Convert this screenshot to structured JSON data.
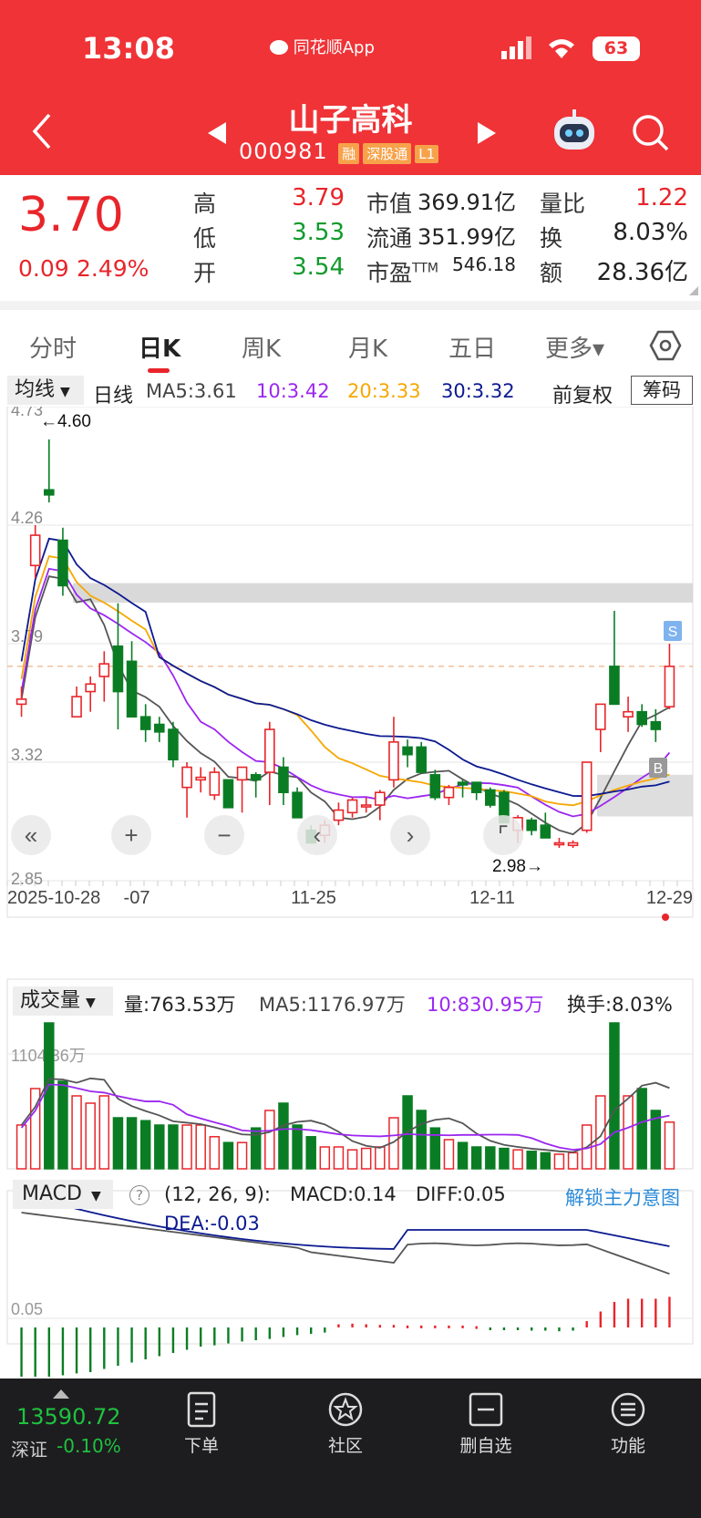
{
  "status": {
    "time": "13:08",
    "app": "同花顺App",
    "battery": "63"
  },
  "header": {
    "name": "山子高科",
    "code": "000981",
    "badges": [
      "融",
      "深股通",
      "L1"
    ]
  },
  "quote": {
    "price": "3.70",
    "change": "0.09",
    "pct": "2.49%",
    "rows": [
      [
        {
          "l": "高",
          "v": "3.79",
          "c": "red"
        },
        {
          "l": "市值",
          "v": "369.91亿",
          "c": "dark"
        },
        {
          "l": "量比",
          "v": "1.22",
          "c": "red"
        }
      ],
      [
        {
          "l": "低",
          "v": "3.53",
          "c": "green"
        },
        {
          "l": "流通",
          "v": "351.99亿",
          "c": "dark"
        },
        {
          "l": "换",
          "v": "8.03%",
          "c": "dark"
        }
      ],
      [
        {
          "l": "开",
          "v": "3.54",
          "c": "green"
        },
        {
          "l": "市盈",
          "v": "546.18",
          "c": "dark",
          "sup": "TTM"
        },
        {
          "l": "额",
          "v": "28.36亿",
          "c": "dark"
        }
      ]
    ]
  },
  "tabs": [
    "分时",
    "日K",
    "周K",
    "月K",
    "五日",
    "更多▾"
  ],
  "active_tab": "日K",
  "kline": {
    "ma_select": "均线",
    "period": "日线",
    "ma5": "MA5:3.61",
    "ma10": "10:3.42",
    "ma20": "20:3.33",
    "ma30": "30:3.32",
    "adjust": "前复权",
    "chip": "筹码",
    "y_labels": [
      "4.73",
      "4.26",
      "3.79",
      "3.32",
      "2.85"
    ],
    "max_label": "←4.60",
    "min_label": "2.98→",
    "x_labels": [
      "2025-10-28",
      "-07",
      "11-25",
      "12-11",
      "12-29"
    ],
    "colors": {
      "up": "#e8252a",
      "down": "#0a7d24",
      "ma5": "#555555",
      "ma10": "#9b27f0",
      "ma20": "#f6a700",
      "ma30": "#0c1a90"
    }
  },
  "volume": {
    "select": "成交量",
    "vol": "量:763.53万",
    "ma5": "MA5:1176.97万",
    "ma10": "10:830.95万",
    "turnover": "换手:8.03%",
    "y_label": "1104.36万"
  },
  "macd": {
    "select": "MACD",
    "params": "(12, 26, 9):",
    "macd": "MACD:0.14",
    "diff": "DIFF:0.05",
    "dea": "DEA:-0.03",
    "unlock": "解锁主力意图",
    "y_label": "0.05"
  },
  "chart_data": [
    {
      "type": "candlestick",
      "title": "山子高科 日K",
      "x": [
        "2025-10-28",
        "11-07",
        "11-25",
        "12-11",
        "12-29"
      ],
      "ylim": [
        2.85,
        4.73
      ],
      "ohlc_approx": [
        [
          3.55,
          3.62,
          3.5,
          3.57
        ],
        [
          4.1,
          4.26,
          4.05,
          4.22
        ],
        [
          4.4,
          4.6,
          4.35,
          4.38
        ],
        [
          4.2,
          4.25,
          3.98,
          4.02
        ],
        [
          3.5,
          3.62,
          3.5,
          3.58
        ],
        [
          3.6,
          3.66,
          3.52,
          3.63
        ],
        [
          3.66,
          3.76,
          3.56,
          3.71
        ],
        [
          3.78,
          3.95,
          3.45,
          3.6
        ],
        [
          3.72,
          3.8,
          3.5,
          3.5
        ],
        [
          3.5,
          3.55,
          3.4,
          3.45
        ],
        [
          3.47,
          3.5,
          3.4,
          3.44
        ],
        [
          3.45,
          3.48,
          3.3,
          3.33
        ],
        [
          3.22,
          3.32,
          3.1,
          3.3
        ],
        [
          3.25,
          3.3,
          3.2,
          3.26
        ],
        [
          3.19,
          3.3,
          3.17,
          3.28
        ],
        [
          3.25,
          3.25,
          3.14,
          3.14
        ],
        [
          3.25,
          3.3,
          3.12,
          3.3
        ],
        [
          3.27,
          3.28,
          3.18,
          3.25
        ],
        [
          3.28,
          3.48,
          3.15,
          3.45
        ],
        [
          3.3,
          3.34,
          3.15,
          3.2
        ],
        [
          3.2,
          3.22,
          3.1,
          3.1
        ],
        [
          3.05,
          3.07,
          3.0,
          3.0
        ],
        [
          3.03,
          3.09,
          3.0,
          3.07
        ],
        [
          3.09,
          3.16,
          3.07,
          3.13
        ],
        [
          3.12,
          3.18,
          3.1,
          3.17
        ],
        [
          3.15,
          3.18,
          3.12,
          3.15
        ],
        [
          3.15,
          3.21,
          3.09,
          3.2
        ],
        [
          3.25,
          3.5,
          3.22,
          3.4
        ],
        [
          3.38,
          3.41,
          3.3,
          3.35
        ],
        [
          3.38,
          3.4,
          3.28,
          3.28
        ],
        [
          3.27,
          3.29,
          3.17,
          3.18
        ],
        [
          3.18,
          3.23,
          3.15,
          3.22
        ],
        [
          3.24,
          3.25,
          3.18,
          3.23
        ],
        [
          3.24,
          3.24,
          3.17,
          3.2
        ],
        [
          3.21,
          3.22,
          3.14,
          3.15
        ],
        [
          3.2,
          3.21,
          3.08,
          3.08
        ],
        [
          3.05,
          3.11,
          3.0,
          3.1
        ],
        [
          3.09,
          3.1,
          3.03,
          3.05
        ],
        [
          3.07,
          3.12,
          3.02,
          3.02
        ],
        [
          3.0,
          3.02,
          2.98,
          3.0
        ],
        [
          2.99,
          3.01,
          2.98,
          3.0
        ],
        [
          3.05,
          3.32,
          3.04,
          3.32
        ],
        [
          3.45,
          3.5,
          3.36,
          3.55
        ],
        [
          3.7,
          3.92,
          3.6,
          3.55
        ],
        [
          3.5,
          3.58,
          3.44,
          3.52
        ],
        [
          3.52,
          3.55,
          3.46,
          3.47
        ],
        [
          3.48,
          3.53,
          3.4,
          3.45
        ],
        [
          3.54,
          3.79,
          3.53,
          3.7
        ]
      ],
      "ma_latest": {
        "MA5": 3.61,
        "MA10": 3.42,
        "MA20": 3.33,
        "MA30": 3.32
      }
    },
    {
      "type": "bar",
      "title": "成交量",
      "ylabel": "万",
      "series": [
        {
          "name": "量",
          "latest": 763.53
        },
        {
          "name": "MA5",
          "latest": 1176.97
        },
        {
          "name": "MA10",
          "latest": 830.95
        }
      ]
    },
    {
      "type": "bar",
      "title": "MACD",
      "series": [
        {
          "name": "MACD",
          "latest": 0.14
        },
        {
          "name": "DIFF",
          "latest": 0.05
        },
        {
          "name": "DEA",
          "latest": -0.03
        }
      ]
    }
  ],
  "bottom": {
    "index_value": "13590.72",
    "index_name": "深证",
    "index_pct": "-0.10%",
    "nav": [
      "下单",
      "社区",
      "删自选",
      "功能"
    ]
  }
}
